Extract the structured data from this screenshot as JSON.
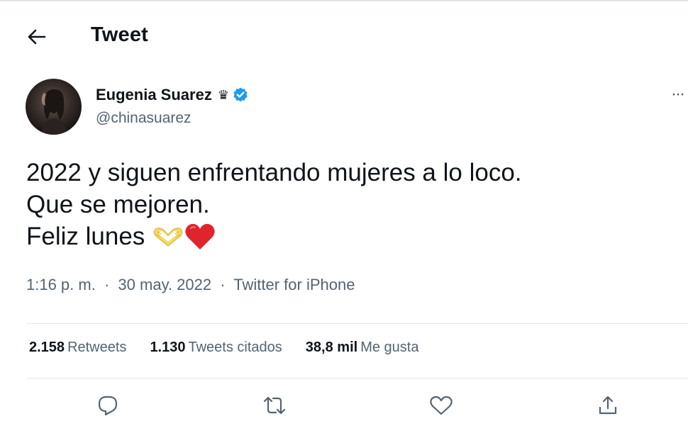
{
  "header": {
    "back_icon": "arrow-left-icon",
    "title": "Tweet"
  },
  "author": {
    "display_name": "Eugenia Suarez",
    "name_emoji": "♛",
    "verified_icon": "verified-badge-icon",
    "verified_color": "#1d9bf0",
    "handle": "@chinasuarez"
  },
  "more_icon": "more-options-icon",
  "more_label": "···",
  "tweet": {
    "lines": [
      "2022 y siguen enfrentando mujeres a lo loco.",
      "Que se mejoren.",
      "Feliz lunes"
    ],
    "emojis": [
      "heart-hands-emoji",
      "red-heart-emoji"
    ]
  },
  "meta": {
    "time": "1:16 p. m.",
    "separator": "·",
    "date": "30 may. 2022",
    "source": "Twitter for iPhone"
  },
  "stats": {
    "retweets_count": "2.158",
    "retweets_label": "Retweets",
    "quotes_count": "1.130",
    "quotes_label": "Tweets citados",
    "likes_count": "38,8 mil",
    "likes_label": "Me gusta"
  },
  "actions": [
    {
      "icon": "reply-icon"
    },
    {
      "icon": "retweet-icon"
    },
    {
      "icon": "like-icon"
    },
    {
      "icon": "share-icon"
    }
  ],
  "colors": {
    "text_primary": "#0f1419",
    "text_secondary": "#536471",
    "divider": "#e1e6ea",
    "heart_red": "#e0242c",
    "heart_hands_yellow": "#f6d964"
  }
}
